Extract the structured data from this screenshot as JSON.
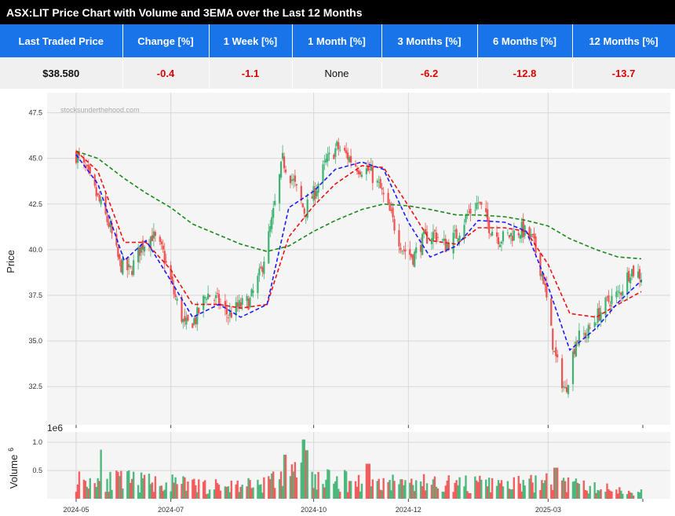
{
  "title": "ASX:LIT Price Chart with Volume and 3EMA over the Last 12 Months",
  "stats": {
    "headers": [
      "Last Traded Price",
      "Change [%]",
      "1 Week [%]",
      "1 Month [%]",
      "3 Months [%]",
      "6 Months [%]",
      "12 Months [%]"
    ],
    "values": [
      "$38.580",
      "-0.4",
      "-1.1",
      "None",
      "-6.2",
      "-12.8",
      "-13.7"
    ]
  },
  "colors": {
    "header_bg": "#1874e8",
    "negative": "#e00000",
    "up_candle": "#3cb371",
    "down_candle": "#f05050",
    "ema_short": "#1a1aff",
    "ema_mid": "#ee1111",
    "ema_long": "#1a8a1a"
  },
  "chart_data": {
    "type": "candlestick",
    "watermark": "stocksunderthehood.com",
    "price_panel": {
      "ylabel": "Price",
      "yticks": [
        "32.5",
        "35.0",
        "37.5",
        "40.0",
        "42.5",
        "45.0",
        "47.5"
      ],
      "ylim": [
        30.4,
        48.6
      ],
      "grid": true
    },
    "volume_panel": {
      "ylabel": "Volume",
      "ylabel_exponent": "6",
      "offset_text": "1e6",
      "yticks": [
        "0.5",
        "1.0"
      ],
      "ylim": [
        0,
        1.1
      ]
    },
    "xlim": [
      "2024-05-01",
      "2025-05-01"
    ],
    "xticks": [
      "2024-05",
      "2024-07",
      "2024-10",
      "2024-12",
      "2025-03"
    ],
    "close_series": {
      "dates": [
        "2024-05-01",
        "2024-05-08",
        "2024-05-15",
        "2024-05-22",
        "2024-05-29",
        "2024-06-05",
        "2024-06-12",
        "2024-06-19",
        "2024-06-26",
        "2024-07-03",
        "2024-07-10",
        "2024-07-17",
        "2024-07-24",
        "2024-07-31",
        "2024-08-07",
        "2024-08-14",
        "2024-08-21",
        "2024-08-28",
        "2024-09-04",
        "2024-09-11",
        "2024-09-18",
        "2024-09-25",
        "2024-10-02",
        "2024-10-09",
        "2024-10-16",
        "2024-10-23",
        "2024-10-30",
        "2024-11-06",
        "2024-11-13",
        "2024-11-20",
        "2024-11-27",
        "2024-12-04",
        "2024-12-11",
        "2024-12-18",
        "2024-12-25",
        "2025-01-01",
        "2025-01-08",
        "2025-01-15",
        "2025-01-22",
        "2025-01-29",
        "2025-02-05",
        "2025-02-12",
        "2025-02-19",
        "2025-02-26",
        "2025-03-05",
        "2025-03-12",
        "2025-03-19",
        "2025-03-26",
        "2025-04-02",
        "2025-04-09",
        "2025-04-16",
        "2025-04-23",
        "2025-04-30"
      ],
      "close": [
        45.2,
        44.2,
        42.8,
        41.4,
        39.2,
        38.8,
        40.2,
        40.8,
        39.8,
        37.6,
        35.8,
        36.2,
        37.6,
        37.2,
        36.4,
        36.9,
        37.2,
        38.8,
        41.5,
        44.9,
        43.7,
        42.1,
        43.2,
        44.8,
        45.6,
        45.1,
        44.5,
        44.3,
        43.3,
        41.8,
        40.1,
        39.6,
        40.6,
        40.9,
        40.2,
        40.8,
        41.9,
        42.6,
        41.3,
        40.6,
        40.8,
        41.1,
        40.5,
        38.4,
        34.3,
        32.2,
        35.1,
        35.4,
        36.4,
        37.2,
        37.6,
        38.9,
        38.58
      ]
    },
    "ema_short": {
      "dates": [
        "2024-05-01",
        "2024-05-15",
        "2024-06-01",
        "2024-06-15",
        "2024-07-01",
        "2024-07-15",
        "2024-08-01",
        "2024-08-15",
        "2024-09-01",
        "2024-09-15",
        "2024-10-01",
        "2024-10-15",
        "2024-11-01",
        "2024-11-15",
        "2024-12-01",
        "2024-12-15",
        "2025-01-01",
        "2025-01-15",
        "2025-02-01",
        "2025-02-15",
        "2025-03-01",
        "2025-03-15",
        "2025-04-01",
        "2025-04-15",
        "2025-04-30"
      ],
      "values": [
        45.2,
        43.6,
        39.4,
        40.5,
        38.3,
        36.3,
        37.0,
        36.3,
        37.0,
        42.3,
        43.2,
        44.4,
        44.8,
        44.4,
        41.5,
        39.6,
        40.2,
        41.6,
        41.5,
        41.0,
        38.0,
        34.5,
        35.7,
        37.1,
        38.3
      ]
    },
    "ema_mid": {
      "dates": [
        "2024-05-01",
        "2024-05-15",
        "2024-06-01",
        "2024-06-15",
        "2024-07-01",
        "2024-07-15",
        "2024-08-01",
        "2024-08-15",
        "2024-09-01",
        "2024-09-15",
        "2024-10-01",
        "2024-10-15",
        "2024-11-01",
        "2024-11-15",
        "2024-12-01",
        "2024-12-15",
        "2025-01-01",
        "2025-01-15",
        "2025-02-01",
        "2025-02-15",
        "2025-03-01",
        "2025-03-15",
        "2025-04-01",
        "2025-04-15",
        "2025-04-30"
      ],
      "values": [
        45.4,
        44.3,
        40.4,
        40.4,
        38.9,
        37.0,
        37.0,
        36.8,
        37.0,
        40.7,
        42.4,
        43.6,
        44.6,
        44.5,
        42.4,
        40.5,
        40.3,
        41.2,
        41.2,
        41.0,
        39.2,
        36.5,
        36.3,
        37.0,
        37.7
      ]
    },
    "ema_long": {
      "dates": [
        "2024-05-01",
        "2024-05-15",
        "2024-06-01",
        "2024-06-15",
        "2024-07-01",
        "2024-07-15",
        "2024-08-01",
        "2024-08-15",
        "2024-09-01",
        "2024-09-15",
        "2024-10-01",
        "2024-10-15",
        "2024-11-01",
        "2024-11-15",
        "2024-12-01",
        "2024-12-15",
        "2025-01-01",
        "2025-01-15",
        "2025-02-01",
        "2025-02-15",
        "2025-03-01",
        "2025-03-15",
        "2025-04-01",
        "2025-04-15",
        "2025-04-30"
      ],
      "values": [
        45.4,
        45.0,
        43.9,
        43.1,
        42.3,
        41.4,
        40.8,
        40.3,
        39.9,
        40.2,
        41.0,
        41.6,
        42.2,
        42.5,
        42.4,
        42.2,
        41.9,
        41.9,
        41.8,
        41.6,
        41.3,
        40.6,
        40.0,
        39.6,
        39.5
      ]
    },
    "volume_profile": {
      "dates": [
        "2024-05-01",
        "2024-06-01",
        "2024-07-01",
        "2024-08-01",
        "2024-09-01",
        "2024-09-20",
        "2024-10-01",
        "2024-11-01",
        "2024-12-01",
        "2025-01-01",
        "2025-02-01",
        "2025-03-01",
        "2025-04-01",
        "2025-04-30"
      ],
      "typical_volume_millions": [
        0.35,
        0.33,
        0.28,
        0.22,
        0.3,
        0.48,
        0.35,
        0.32,
        0.3,
        0.28,
        0.25,
        0.3,
        0.2,
        0.12
      ],
      "peaks": [
        {
          "date": "2024-05-18",
          "volume_millions": 0.87
        },
        {
          "date": "2024-09-13",
          "volume_millions": 0.78
        },
        {
          "date": "2024-09-25",
          "volume_millions": 1.05
        },
        {
          "date": "2024-09-27",
          "volume_millions": 0.86
        },
        {
          "date": "2024-11-05",
          "volume_millions": 0.62
        },
        {
          "date": "2025-03-06",
          "volume_millions": 0.55
        }
      ]
    }
  }
}
